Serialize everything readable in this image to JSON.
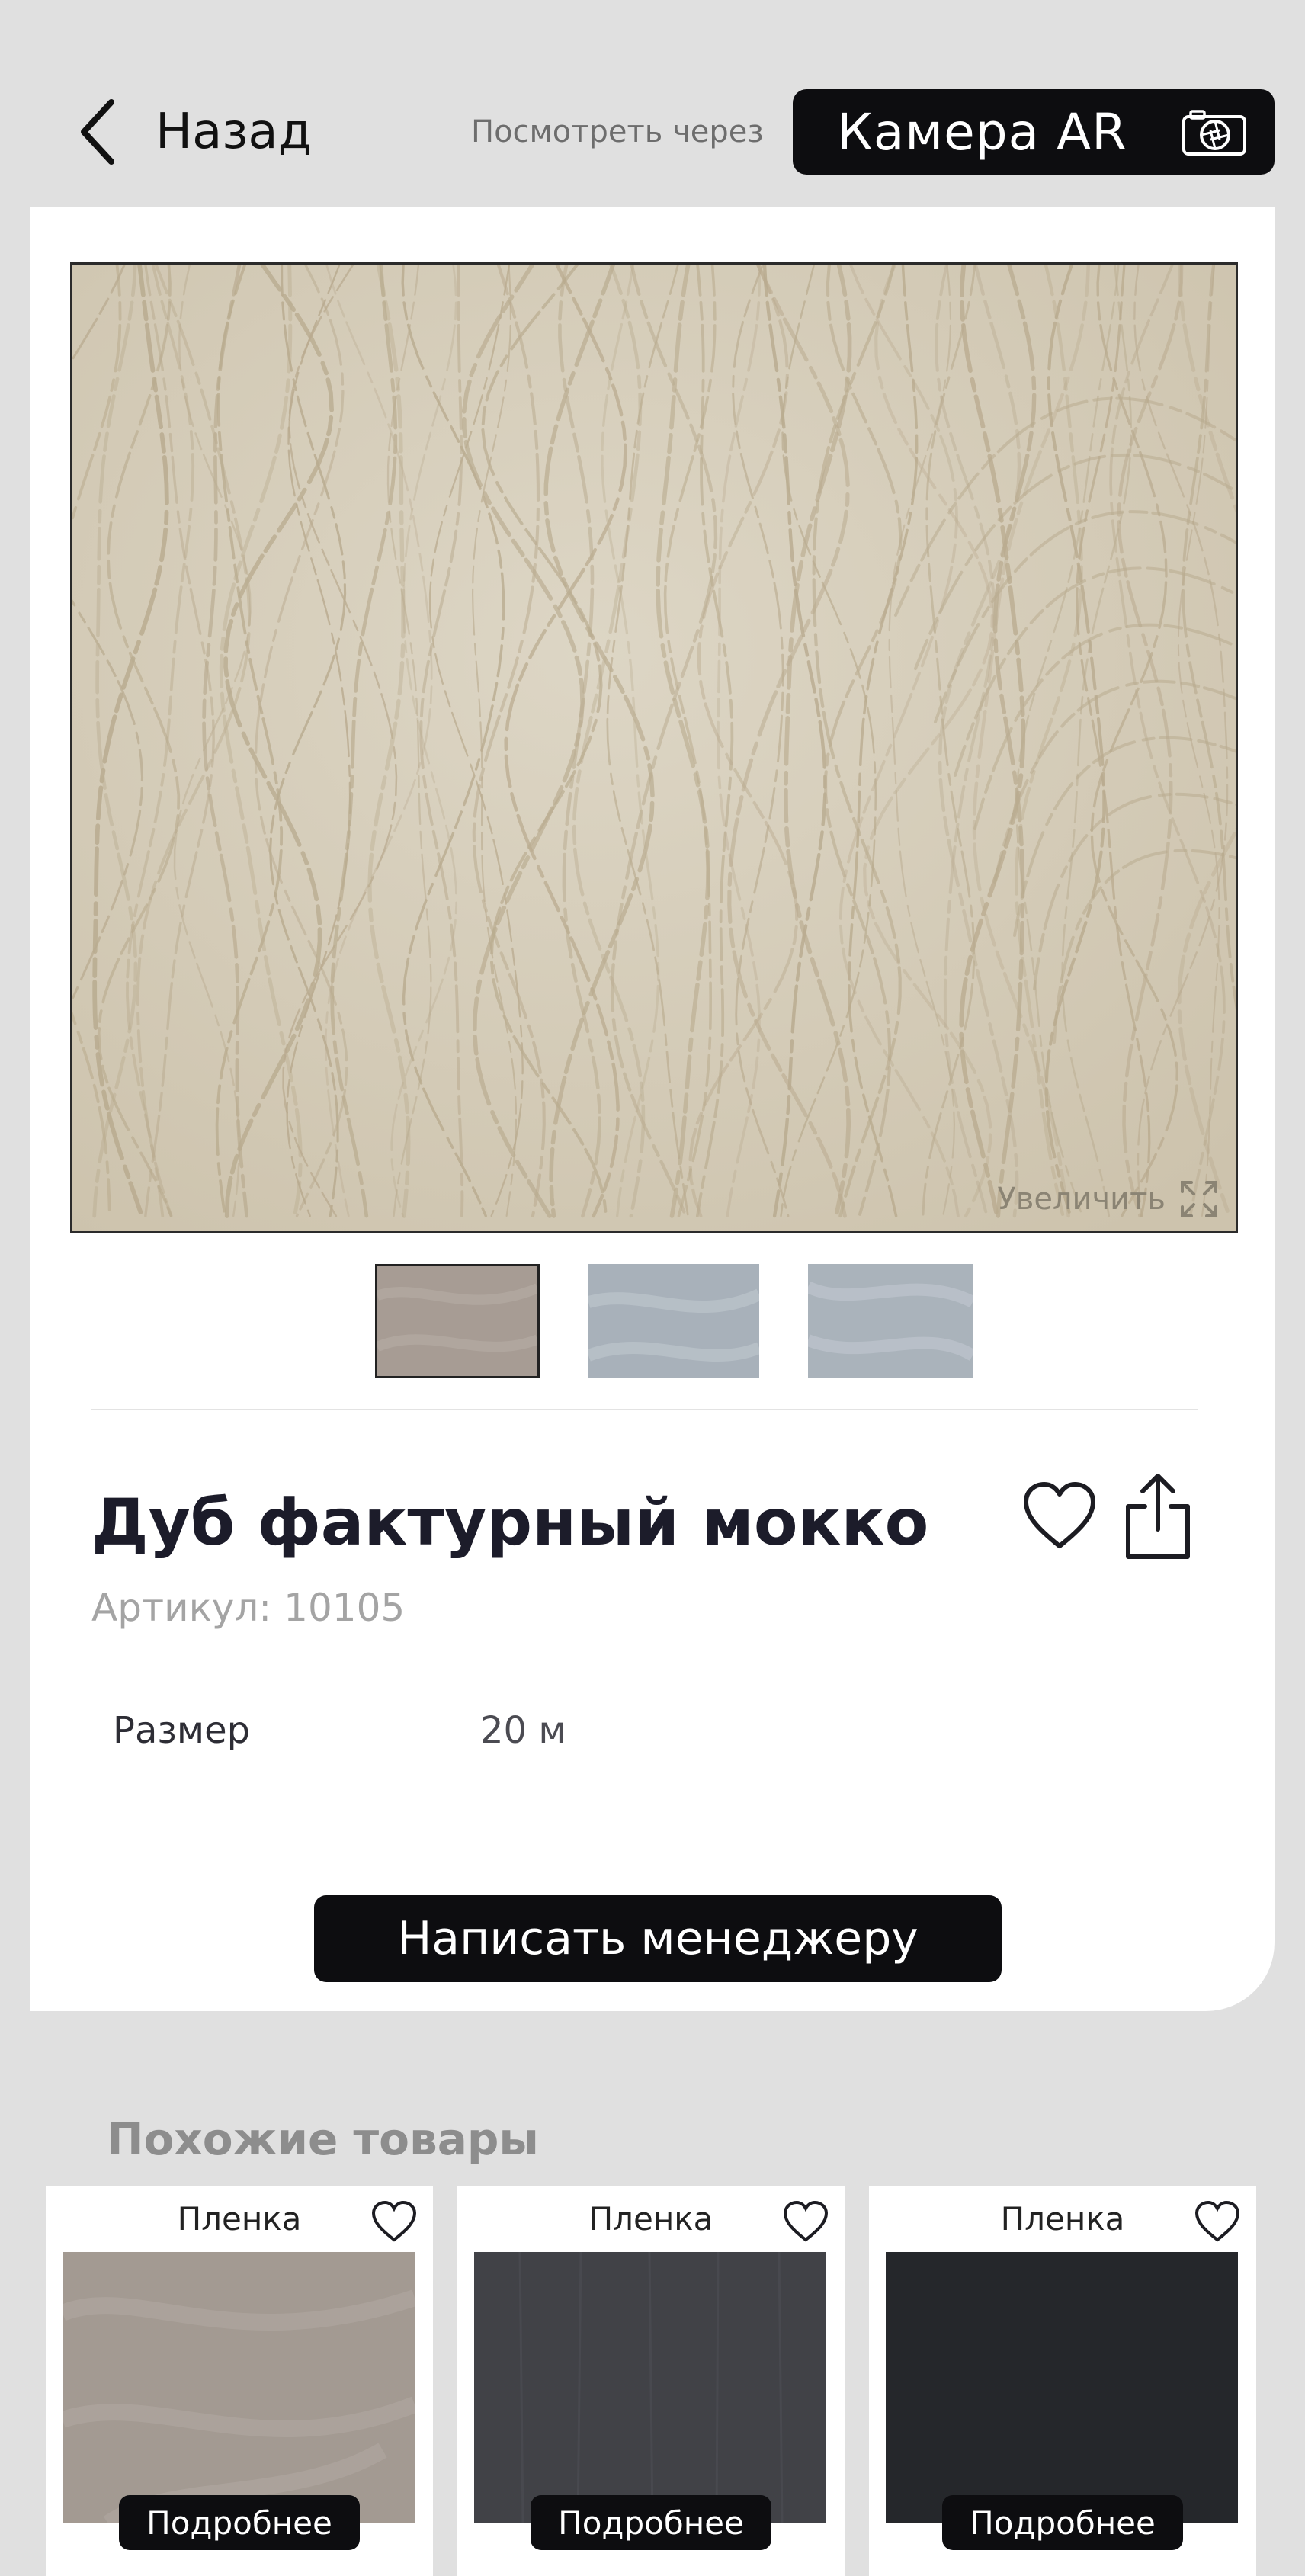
{
  "header": {
    "back_label": "Назад",
    "ar_hint": "Посмотреть через",
    "ar_button_label": "Камера AR"
  },
  "product": {
    "zoom_label": "Увеличить",
    "title": "Дуб фактурный мокко",
    "sku_label": "Артикул:",
    "sku_value": "10105",
    "specs": [
      {
        "label": "Размер",
        "value": "20 м"
      }
    ],
    "manager_button": "Написать менеджеру"
  },
  "similar": {
    "title": "Похожие товары",
    "items": [
      {
        "type": "Пленка",
        "button": "Подробнее",
        "color": "#a39a92"
      },
      {
        "type": "Пленка",
        "button": "Подробнее",
        "color": "#414247"
      },
      {
        "type": "Пленка",
        "button": "Подробнее",
        "color": "#25272b"
      }
    ]
  },
  "colors": {
    "accent": "#0d0d10",
    "background": "#e0e0e0",
    "wood_base": "#d9d1bf",
    "wood_grain": "#b8a98c"
  }
}
